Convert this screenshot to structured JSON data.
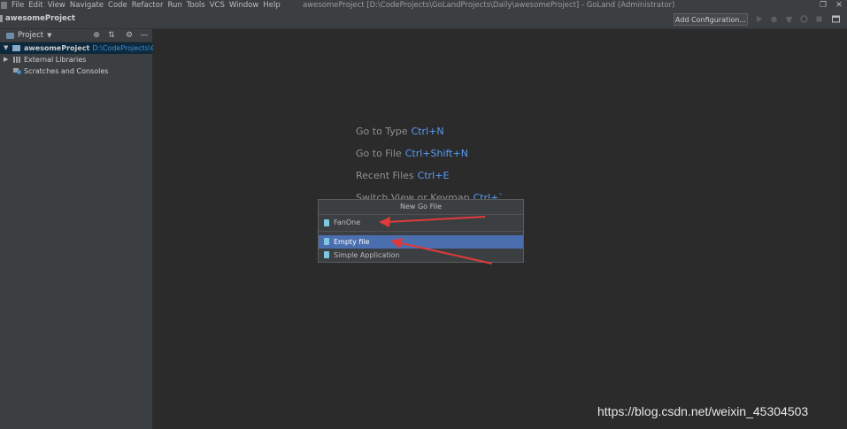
{
  "menubar": {
    "items": [
      "File",
      "Edit",
      "View",
      "Navigate",
      "Code",
      "Refactor",
      "Run",
      "Tools",
      "VCS",
      "Window",
      "Help"
    ],
    "window_title": "awesomeProject [D:\\CodeProjects\\GoLandProjects\\Daily\\awesomeProject] - GoLand (Administrator)"
  },
  "navbar": {
    "project_name": "awesomeProject",
    "add_configuration": "Add Configuration..."
  },
  "sidebar": {
    "header_label": "Project",
    "tree": [
      {
        "label": "awesomeProject",
        "path": "D:\\CodeProjects\\Go"
      },
      {
        "label": "External Libraries"
      },
      {
        "label": "Scratches and Consoles"
      }
    ]
  },
  "editor": {
    "hints": [
      {
        "label": "Go to Type",
        "key": "Ctrl+N"
      },
      {
        "label": "Go to File",
        "key": "Ctrl+Shift+N"
      },
      {
        "label": "Recent Files",
        "key": "Ctrl+E"
      },
      {
        "label": "Switch View or Keymap",
        "key": "Ctrl+`"
      }
    ]
  },
  "popup": {
    "title": "New Go File",
    "input_value": "FanOne",
    "options": [
      "Empty file",
      "Simple Application"
    ],
    "selected_index": 0
  },
  "watermark": "https://blog.csdn.net/weixin_45304503"
}
